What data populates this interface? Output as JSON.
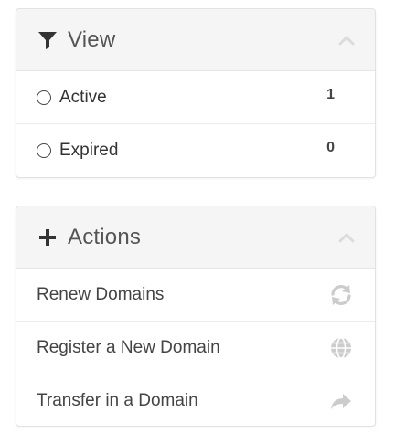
{
  "view_panel": {
    "title": "View",
    "icon": "filter-icon",
    "options": [
      {
        "label": "Active",
        "count": "1"
      },
      {
        "label": "Expired",
        "count": "0"
      }
    ]
  },
  "actions_panel": {
    "title": "Actions",
    "icon": "plus-icon",
    "items": [
      {
        "label": "Renew Domains",
        "icon": "refresh-icon"
      },
      {
        "label": "Register a New Domain",
        "icon": "globe-icon"
      },
      {
        "label": "Transfer in a Domain",
        "icon": "share-arrow-icon"
      }
    ]
  },
  "colors": {
    "header_bg": "#f5f5f5",
    "border": "#e2e2e2",
    "text": "#333333",
    "icon_muted": "#cccccc"
  }
}
